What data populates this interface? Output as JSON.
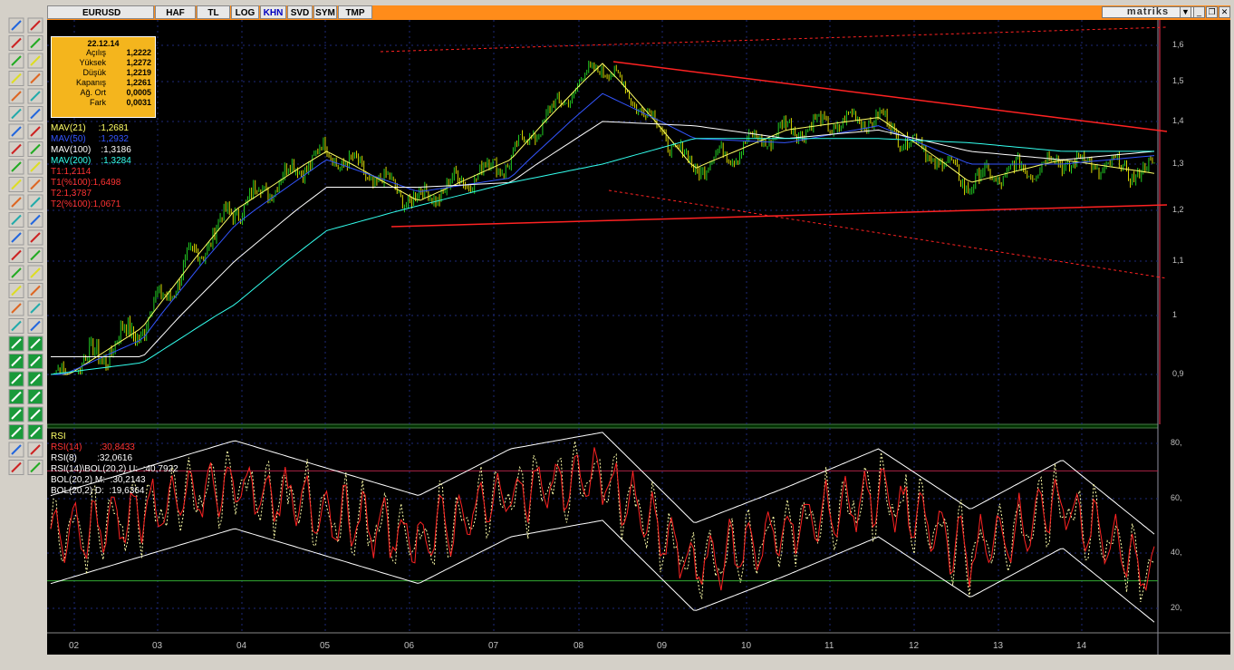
{
  "toolbar": {
    "symbol": "EURUSD",
    "tabs": [
      "HAF",
      "TL",
      "LOG",
      "KHN",
      "SVD",
      "SYM",
      "TMP"
    ],
    "brand": "matriks",
    "controls": [
      "▼",
      "_",
      "❐",
      "✕"
    ]
  },
  "info": {
    "date": "22.12.14",
    "rows": [
      {
        "k": "Açılış",
        "v": "1,2222"
      },
      {
        "k": "Yüksek",
        "v": "1,2272"
      },
      {
        "k": "Düşük",
        "v": "1,2219"
      },
      {
        "k": "Kapanış",
        "v": "1,2261"
      },
      {
        "k": "Ağ. Ort",
        "v": "0,0005"
      },
      {
        "k": "Fark",
        "v": "0,0031"
      }
    ]
  },
  "legend_main": [
    {
      "t": "MAV(21)     :1,2681",
      "c": "#ffff66"
    },
    {
      "t": "MAV(50)     :1,2932",
      "c": "#3355ff"
    },
    {
      "t": "MAV(100)    :1,3186",
      "c": "#ffffff"
    },
    {
      "t": "MAV(200)    :1,3284",
      "c": "#33ffee"
    },
    {
      "t": "T1:1,2114",
      "c": "#ff3333"
    },
    {
      "t": "T1(%100):1,6498",
      "c": "#ff3333"
    },
    {
      "t": "T2:1,3787",
      "c": "#ff3333"
    },
    {
      "t": "T2(%100):1,0671",
      "c": "#ff3333"
    }
  ],
  "legend_rsi": [
    {
      "t": "RSI",
      "c": "#ffff66"
    },
    {
      "t": "RSI(14)       :30,8433",
      "c": "#ff3333"
    },
    {
      "t": "RSI(8)        :32,0616",
      "c": "#ffffff"
    },
    {
      "t": "RSI(14)\\BOL(20,2) U:  :40,7922",
      "c": "#ffffff"
    },
    {
      "t": "BOL(20,2) M:  :30,2143",
      "c": "#ffffff"
    },
    {
      "t": "BOL(20,2) D:  :19,6364",
      "c": "#ffffff"
    }
  ],
  "price_axis": [
    "1,6",
    "1,5",
    "1,4",
    "1,3",
    "1,2",
    "1,1",
    "1",
    "0,9"
  ],
  "rsi_axis": [
    "80,",
    "60,",
    "40,",
    "20,"
  ],
  "months": [
    "02",
    "03",
    "04",
    "05",
    "06",
    "07",
    "08",
    "09",
    "10",
    "11",
    "12",
    "13",
    "14"
  ],
  "chart_data": {
    "type": "line",
    "title": "EURUSD",
    "xlabel": "",
    "ylabel": "",
    "ylim": [
      0.85,
      1.65
    ],
    "x": [
      "02",
      "03",
      "04",
      "05",
      "06",
      "07",
      "08",
      "09",
      "10",
      "11",
      "12",
      "13",
      "14"
    ],
    "series": [
      {
        "name": "MAV(21)",
        "values": [
          0.88,
          0.98,
          1.2,
          1.33,
          1.22,
          1.31,
          1.55,
          1.29,
          1.38,
          1.41,
          1.26,
          1.31,
          1.28
        ]
      },
      {
        "name": "MAV(50)",
        "values": [
          0.89,
          0.96,
          1.17,
          1.31,
          1.24,
          1.27,
          1.47,
          1.36,
          1.35,
          1.39,
          1.3,
          1.3,
          1.32
        ]
      },
      {
        "name": "MAV(100)",
        "values": [
          0.93,
          0.93,
          1.1,
          1.25,
          1.25,
          1.26,
          1.4,
          1.39,
          1.36,
          1.38,
          1.33,
          1.31,
          1.33
        ]
      },
      {
        "name": "MAV(200)",
        "values": [
          0.9,
          0.92,
          1.02,
          1.16,
          1.21,
          1.26,
          1.3,
          1.36,
          1.36,
          1.36,
          1.35,
          1.33,
          1.33
        ]
      }
    ],
    "rsi_ylim": [
      10,
      85
    ],
    "rsi_series": [
      {
        "name": "RSI(14)",
        "values": [
          45,
          55,
          65,
          55,
          45,
          62,
          68,
          35,
          48,
          62,
          40,
          58,
          31
        ]
      }
    ],
    "rsi_levels": [
      30,
      70
    ]
  }
}
